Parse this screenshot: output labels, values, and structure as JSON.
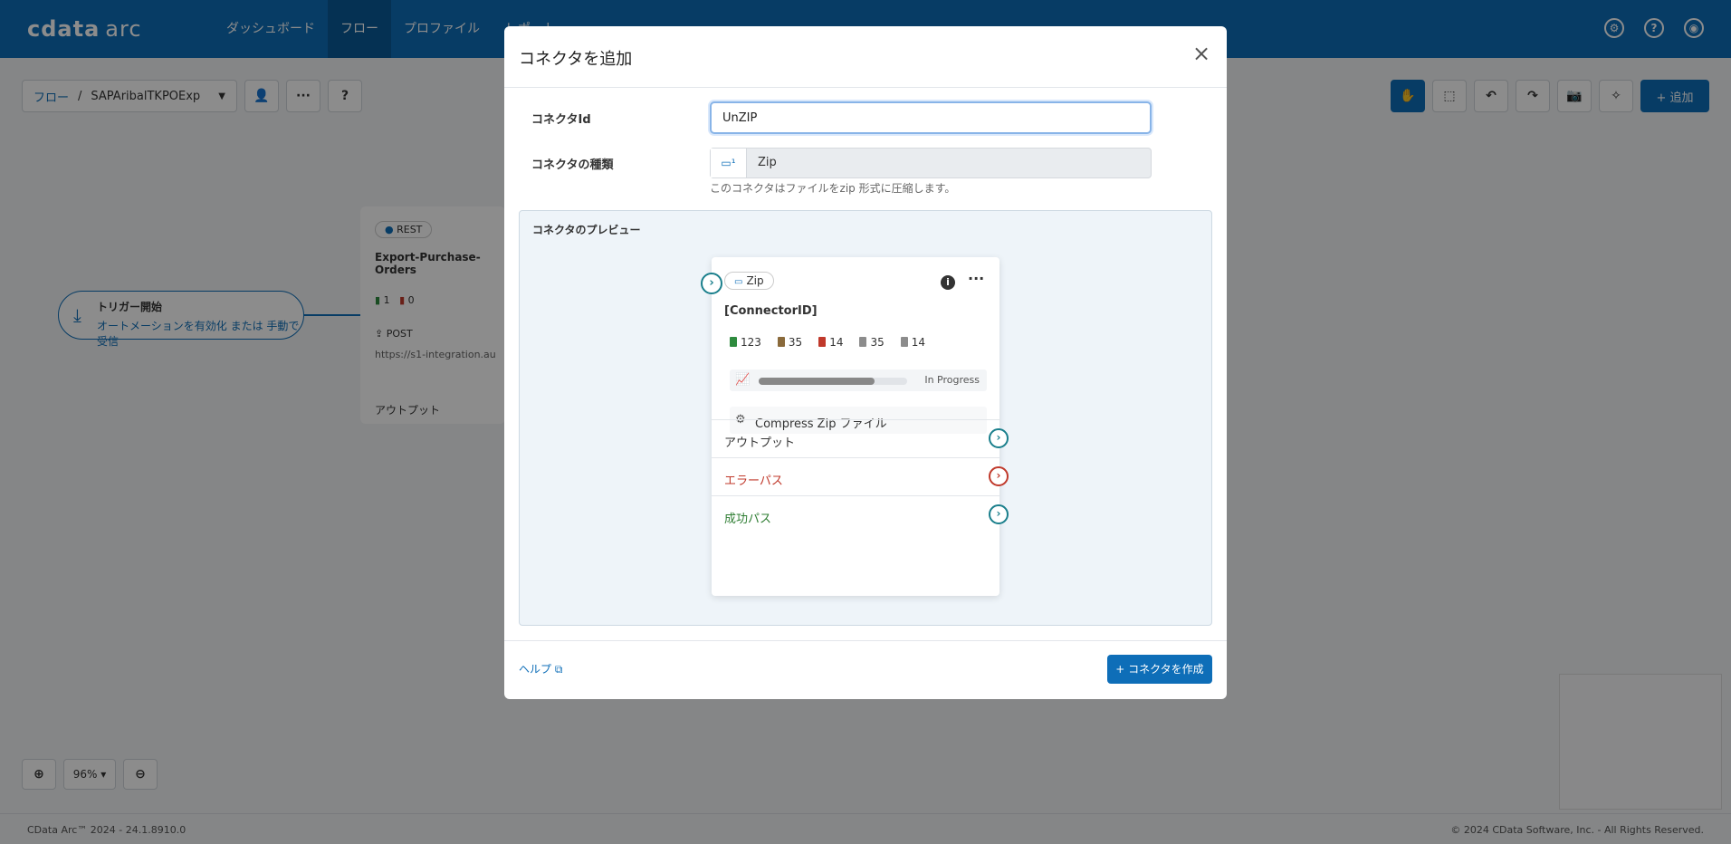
{
  "app": {
    "logo": "cdata",
    "logo_suffix": "arc"
  },
  "nav": {
    "items": [
      {
        "label": "ダッシュボード",
        "active": false
      },
      {
        "label": "フロー",
        "active": true
      },
      {
        "label": "プロファイル",
        "active": false
      },
      {
        "label": "レポート",
        "active": false
      }
    ]
  },
  "topbar": {
    "icons": [
      "gear-icon",
      "help-icon",
      "user-icon"
    ]
  },
  "toolbar": {
    "breadcrumb_root": "フロー",
    "breadcrumb_sep": "/",
    "flow_name": "SAPAribalTKPOExp",
    "more_label": "···",
    "help_label": "?"
  },
  "right_toolbar": {
    "add_label": "+ 追加"
  },
  "canvas": {
    "trigger": {
      "title": "トリガー開始",
      "subtitle": "オートメーションを有効化 または 手動で受信"
    },
    "rest_card": {
      "badge": "REST",
      "title": "Export-Purchase-Orders",
      "success_count": "1",
      "error_count": "0",
      "method": "POST",
      "url": "https://s1-integration.au",
      "output": "アウトプット"
    }
  },
  "zoom": {
    "value": "96%"
  },
  "footer": {
    "version": "CData Arc™ 2024 - 24.1.8910.0",
    "copyright": "© 2024 CData Software, Inc. - All Rights Reserved."
  },
  "modal": {
    "title": "コネクタを追加",
    "connector_id_label": "コネクタId",
    "connector_id_value": "UnZIP",
    "connector_type_label": "コネクタの種類",
    "connector_type_value": "Zip",
    "connector_type_hint": "このコネクタはファイルをzip 形式に圧縮します。",
    "preview_label": "コネクタのプレビュー",
    "preview": {
      "type": "Zip",
      "connector_id": "[ConnectorID]",
      "counts": [
        {
          "label": "123",
          "color": "#2e8b3e"
        },
        {
          "label": "35",
          "color": "#8a6a3b"
        },
        {
          "label": "14",
          "color": "#c0392b"
        },
        {
          "label": "35",
          "color": "#8c8c8c"
        },
        {
          "label": "14",
          "color": "#8c8c8c"
        }
      ],
      "progress_fraction": 0.78,
      "progress_status": "In Progress",
      "action": "Compress Zip ファイル",
      "rows": [
        {
          "label": "アウトプット",
          "color": "#333333",
          "port_color": "#1a7f8c"
        },
        {
          "label": "エラーパス",
          "color": "#c0392b",
          "port_color": "#c0392b"
        },
        {
          "label": "成功パス",
          "color": "#2e7d32",
          "port_color": "#1a7f8c"
        }
      ]
    },
    "help_label": "ヘルプ",
    "create_label": "+ コネクタを作成"
  }
}
